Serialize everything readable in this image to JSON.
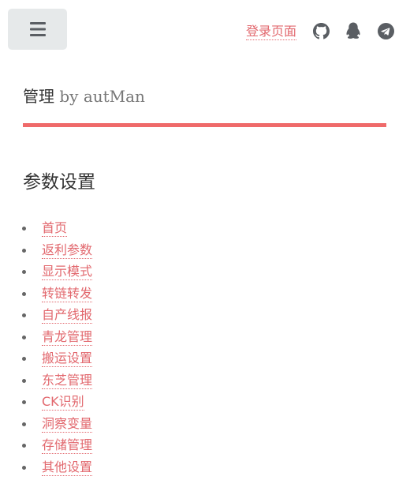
{
  "header": {
    "menu_icon": "hamburger-icon",
    "login_label": "登录页面",
    "social_icons": [
      "github-icon",
      "qq-penguin-icon",
      "telegram-icon"
    ],
    "icon_color": "#5a5e63",
    "link_color": "#e2686e"
  },
  "site": {
    "name": "管理",
    "byline": " by autMan",
    "accent_color": "#ef6a6a"
  },
  "section": {
    "heading": "参数设置",
    "items": [
      {
        "label": "首页"
      },
      {
        "label": "返利参数"
      },
      {
        "label": "显示模式"
      },
      {
        "label": "转链转发"
      },
      {
        "label": "自产线报"
      },
      {
        "label": "青龙管理"
      },
      {
        "label": "搬运设置"
      },
      {
        "label": "东芝管理"
      },
      {
        "label": "CK识别"
      },
      {
        "label": "洞察变量"
      },
      {
        "label": "存储管理"
      },
      {
        "label": "其他设置"
      }
    ]
  }
}
